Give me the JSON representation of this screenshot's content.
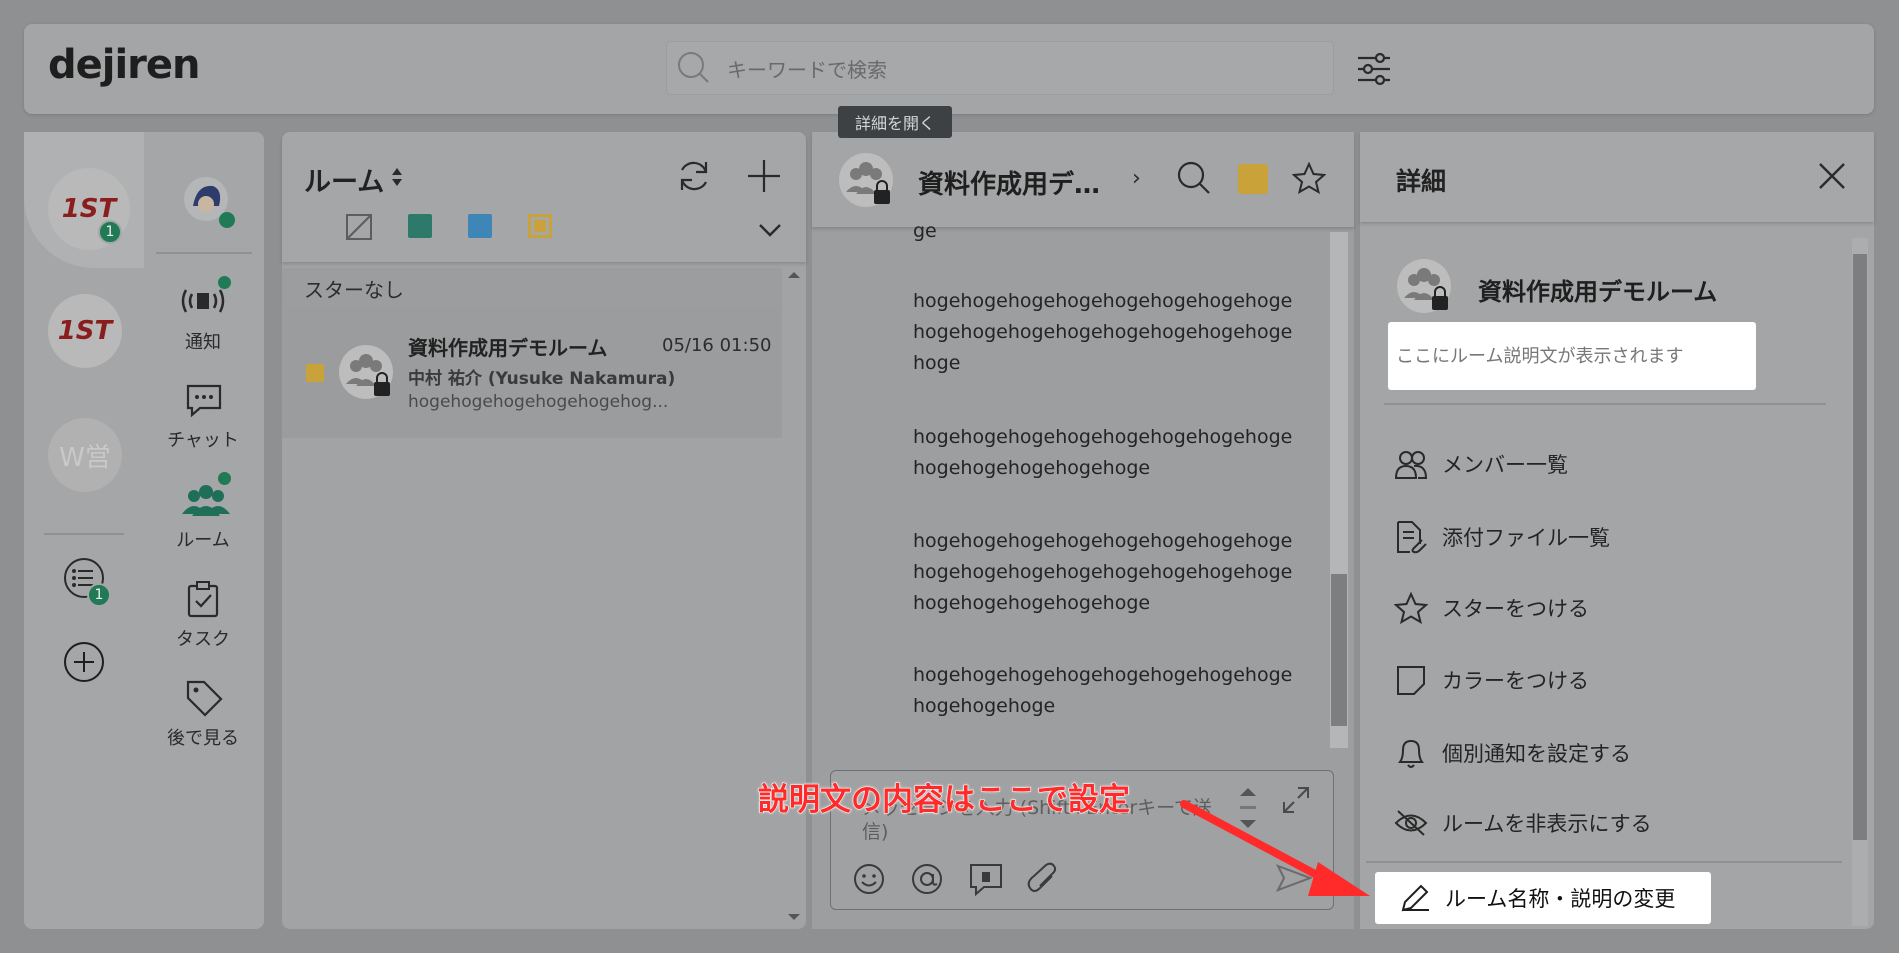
{
  "app": {
    "logo": "dejiren"
  },
  "search": {
    "placeholder": "キーワードで検索"
  },
  "orgs": [
    {
      "label": "1ST",
      "badge": "1"
    },
    {
      "label": "1ST"
    },
    {
      "label": "W営"
    }
  ],
  "rail_task_badge": "1",
  "nav": [
    {
      "label": "通知"
    },
    {
      "label": "チャット"
    },
    {
      "label": "ルーム"
    },
    {
      "label": "タスク"
    },
    {
      "label": "後で見る"
    }
  ],
  "room_list": {
    "title": "ルーム",
    "sort_icon": "sort-arrows-icon",
    "color_filters": [
      "#2e7a6a",
      "#3f86b8",
      "#c9a23a"
    ],
    "section": "スターなし",
    "rooms": [
      {
        "name": "資料作成用デモルーム",
        "time": "05/16 01:50",
        "sender": "中村 祐介 (Yusuke Nakamura)",
        "preview": "hogehogehogehogehogehog...",
        "color": "#c9a23a"
      }
    ]
  },
  "chat": {
    "title": "資料作成用デ…",
    "tooltip": "詳細を開く",
    "color_tag": "#c9a23a",
    "messages": [
      "ge",
      "hogehogehogehogehogehogehogehogehogehogehogehogehogehogehogehogehoge",
      "hogehogehogehogehogehogehogehogehogehogehogehogehoge",
      "hogehogehogehogehogehogehogehogehogehogehogehogehogehogehogehogehogehogehogehogehoge",
      "hogehogehogehogehogehogehogehogehogehogehoge"
    ],
    "composer_placeholder": "メッセージを入力 (Shift+Enterキーで送信)"
  },
  "detail": {
    "title": "詳細",
    "room_name": "資料作成用デモルーム",
    "description": "ここにルーム説明文が表示されます",
    "menu": [
      {
        "label": "メンバー一覧",
        "icon": "members-icon"
      },
      {
        "label": "添付ファイル一覧",
        "icon": "attachment-file-icon"
      },
      {
        "label": "スターをつける",
        "icon": "star-icon"
      },
      {
        "label": "カラーをつける",
        "icon": "color-tag-icon"
      },
      {
        "label": "個別通知を設定する",
        "icon": "bell-icon"
      },
      {
        "label": "ルームを非表示にする",
        "icon": "eye-off-icon"
      }
    ],
    "edit_label": "ルーム名称・説明の変更"
  },
  "annotation": {
    "text": "説明文の内容はここで設定",
    "color": "#ff2a2a"
  }
}
